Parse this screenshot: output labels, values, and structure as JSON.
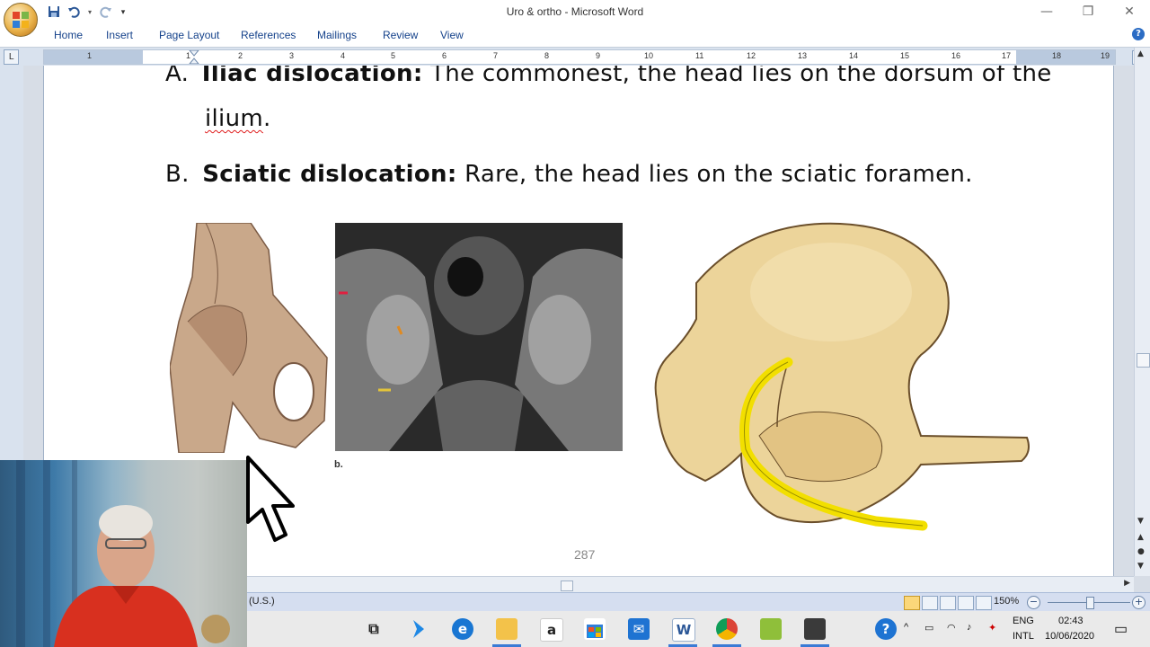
{
  "window": {
    "title": "Uro & ortho - Microsoft Word",
    "minimize": "—",
    "maximize": "❐",
    "close": "✕"
  },
  "qat": {
    "save_icon": "save-icon",
    "undo_icon": "undo-icon",
    "redo_icon": "redo-icon",
    "customize_icon": "dropdown-icon"
  },
  "ribbon": {
    "tabs": [
      "Home",
      "Insert",
      "Page Layout",
      "References",
      "Mailings",
      "Review",
      "View"
    ],
    "help": "?"
  },
  "ruler": {
    "numbers": [
      "1",
      "1",
      "2",
      "3",
      "4",
      "5",
      "6",
      "7",
      "8",
      "9",
      "10",
      "11",
      "12",
      "13",
      "14",
      "15",
      "16",
      "17",
      "18",
      "19"
    ]
  },
  "document": {
    "line_a": {
      "marker": "A.",
      "term": "Iliac dislocation:",
      "rest": " The commonest, the head lies on the dorsum of the"
    },
    "line_a2": {
      "word": "ilium",
      "punct": "."
    },
    "line_b": {
      "marker": "B.",
      "term": "Sciatic dislocation:",
      "rest": " Rare, the head lies on the sciatic foramen."
    },
    "figure_label": "b.",
    "page_number": "287"
  },
  "statusbar": {
    "language": "(U.S.)",
    "zoom": "150%",
    "zoom_minus": "−",
    "zoom_plus": "+"
  },
  "taskbar": {
    "tray_lang_1": "ENG",
    "tray_lang_2": "INTL",
    "time": "02:43",
    "date": "10/06/2020"
  },
  "colors": {
    "accent": "#15428b",
    "bone": "#ecd49a",
    "highlight_band": "#f2df00"
  }
}
